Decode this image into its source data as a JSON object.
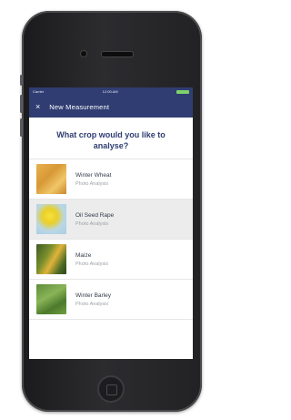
{
  "status_bar": {
    "carrier": "Carrier",
    "time": "12:00 AM"
  },
  "nav": {
    "close_icon": "×",
    "title": "New Measurement"
  },
  "question": "What crop would you like to analyse?",
  "crops": [
    {
      "name": "Winter Wheat",
      "subtitle": "Photo Analysis",
      "thumb": "wheat"
    },
    {
      "name": "Oil Seed Rape",
      "subtitle": "Photo Analysis",
      "thumb": "rape",
      "selected": true
    },
    {
      "name": "Maize",
      "subtitle": "Photo Analysis",
      "thumb": "maize"
    },
    {
      "name": "Winter Barley",
      "subtitle": "Photo Analysis",
      "thumb": "barley"
    }
  ],
  "colors": {
    "header": "#2f3d72",
    "question": "#2f3d72",
    "selected_row": "#ececec"
  }
}
